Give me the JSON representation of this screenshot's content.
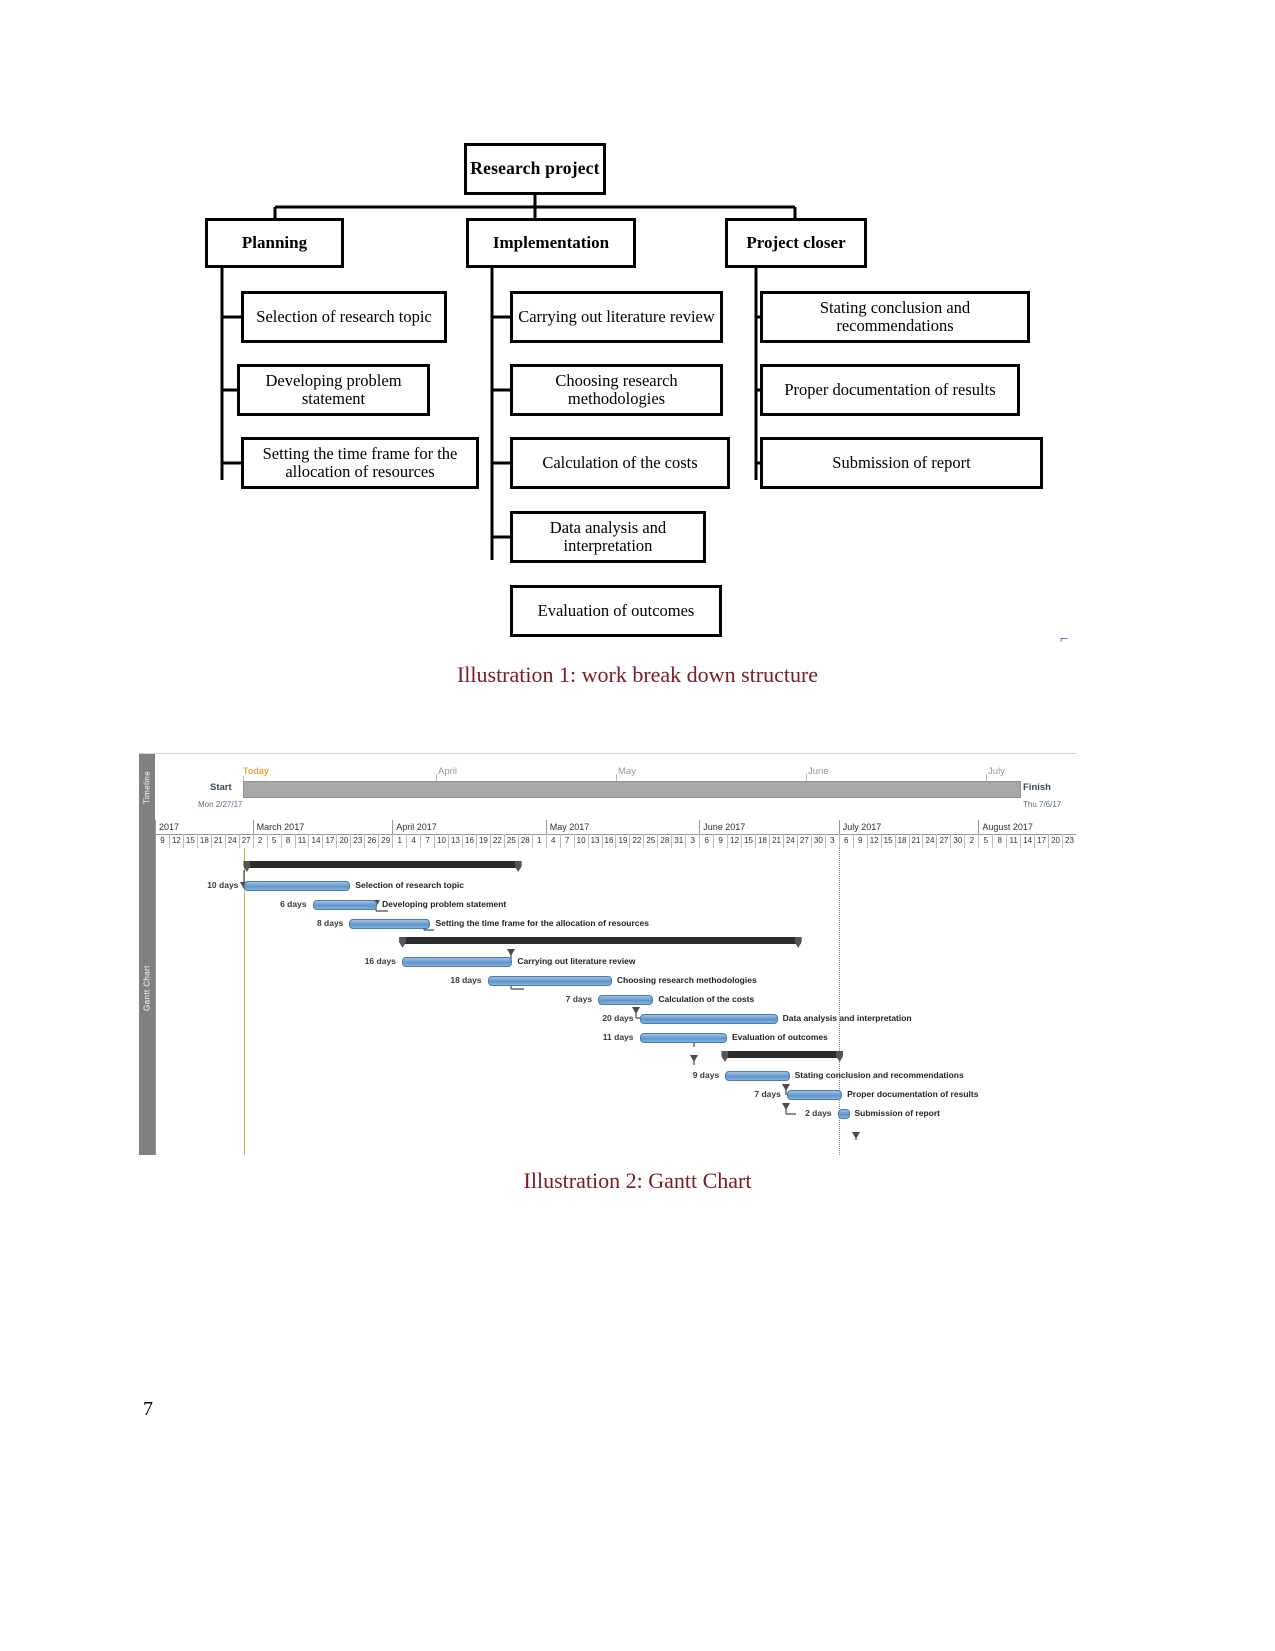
{
  "document": {
    "page_number": "7"
  },
  "wbs": {
    "root": "Research project",
    "branches": [
      {
        "title": "Planning",
        "items": [
          "Selection of research topic",
          "Developing problem statement",
          "Setting the time frame for the allocation of resources"
        ]
      },
      {
        "title": "Implementation",
        "items": [
          "Carrying out literature review",
          "Choosing research methodologies",
          "Calculation of the costs",
          "Data analysis and interpretation",
          "Evaluation of outcomes"
        ]
      },
      {
        "title": "Project closer",
        "items": [
          "Stating conclusion and recommendations",
          "Proper documentation of results",
          "Submission of report"
        ]
      }
    ]
  },
  "captions": {
    "illustration_1": "Illustration 1: work break down structure",
    "illustration_2": "Illustration 2: Gantt Chart",
    "color": "#7b1b22"
  },
  "gantt": {
    "panel_label_timeline": "Timeline",
    "panel_label_chart": "Gantt Chart",
    "timeline": {
      "today_label": "Today",
      "start_label": "Start",
      "start_date": "Mon 2/27/17",
      "finish_label": "Finish",
      "finish_date": "Thu 7/6/17",
      "months": [
        "April",
        "May",
        "June",
        "July"
      ]
    },
    "header_months": [
      "2017",
      "March 2017",
      "April 2017",
      "May 2017",
      "June 2017",
      "July 2017",
      "August 2017"
    ],
    "header_days": [
      "9",
      "12",
      "15",
      "18",
      "21",
      "24",
      "27",
      "2",
      "5",
      "8",
      "11",
      "14",
      "17",
      "20",
      "23",
      "26",
      "29",
      "1",
      "4",
      "7",
      "10",
      "13",
      "16",
      "19",
      "22",
      "25",
      "28",
      "1",
      "4",
      "7",
      "10",
      "13",
      "16",
      "19",
      "22",
      "25",
      "28",
      "31",
      "3",
      "6",
      "9",
      "12",
      "15",
      "18",
      "21",
      "24",
      "27",
      "30",
      "3",
      "6",
      "9",
      "12",
      "15",
      "18",
      "21",
      "24",
      "27",
      "30",
      "2",
      "5",
      "8",
      "11",
      "14",
      "17",
      "20",
      "23"
    ]
  },
  "chart_data": {
    "type": "bar",
    "title": "Illustration 2: Gantt Chart",
    "xlabel": "",
    "ylabel": "",
    "categories": [
      "Planning (summary)",
      "Selection of research topic",
      "Developing problem statement",
      "Setting the time frame for the allocation of resources",
      "Implementation (summary)",
      "Carrying out literature review",
      "Choosing research methodologies",
      "Calculation of the costs",
      "Data analysis and interpretation",
      "Evaluation of outcomes",
      "Project closer (summary)",
      "Stating conclusion and recommendations",
      "Proper documentation of results",
      "Submission of report"
    ],
    "values": [
      null,
      10,
      6,
      8,
      null,
      16,
      18,
      7,
      20,
      11,
      null,
      9,
      7,
      2
    ],
    "value_labels": [
      "",
      "10 days",
      "6 days",
      "8 days",
      "",
      "16 days",
      "18 days",
      "7 days",
      "20 days",
      "11 days",
      "",
      "9 days",
      "7 days",
      "2 days"
    ],
    "tasks": [
      {
        "name": "",
        "days": "",
        "summary": true,
        "start_pct": 9.6,
        "width_pct": 30.0,
        "row": 0
      },
      {
        "name": "Selection of research topic",
        "days": "10 days",
        "summary": false,
        "start_pct": 9.6,
        "width_pct": 11.5,
        "row": 1
      },
      {
        "name": "Developing problem statement",
        "days": "6 days",
        "summary": false,
        "start_pct": 17.0,
        "width_pct": 7.0,
        "row": 2
      },
      {
        "name": "Setting the time frame for the allocation of resources",
        "days": "8 days",
        "summary": false,
        "start_pct": 21.0,
        "width_pct": 8.8,
        "row": 3
      },
      {
        "name": "",
        "days": "",
        "summary": true,
        "start_pct": 26.5,
        "width_pct": 43.5,
        "row": 4
      },
      {
        "name": "Carrying out literature review",
        "days": "16 days",
        "summary": false,
        "start_pct": 26.7,
        "width_pct": 12.0,
        "row": 5
      },
      {
        "name": "Choosing research methodologies",
        "days": "18 days",
        "summary": false,
        "start_pct": 36.0,
        "width_pct": 13.5,
        "row": 6
      },
      {
        "name": "Calculation of the costs",
        "days": "7 days",
        "summary": false,
        "start_pct": 48.0,
        "width_pct": 6.0,
        "row": 7
      },
      {
        "name": "Data analysis and interpretation",
        "days": "20 days",
        "summary": false,
        "start_pct": 52.5,
        "width_pct": 15.0,
        "row": 8
      },
      {
        "name": "Evaluation of outcomes",
        "days": "11 days",
        "summary": false,
        "start_pct": 52.5,
        "width_pct": 9.5,
        "row": 9
      },
      {
        "name": "",
        "days": "",
        "summary": true,
        "start_pct": 61.5,
        "width_pct": 13.0,
        "row": 10
      },
      {
        "name": "Stating conclusion and recommendations",
        "days": "9 days",
        "summary": false,
        "start_pct": 61.8,
        "width_pct": 7.0,
        "row": 11
      },
      {
        "name": "Proper documentation of results",
        "days": "7 days",
        "summary": false,
        "start_pct": 68.5,
        "width_pct": 6.0,
        "row": 12
      },
      {
        "name": "Submission of report",
        "days": "2 days",
        "summary": false,
        "start_pct": 74.0,
        "width_pct": 1.3,
        "row": 13
      }
    ]
  }
}
